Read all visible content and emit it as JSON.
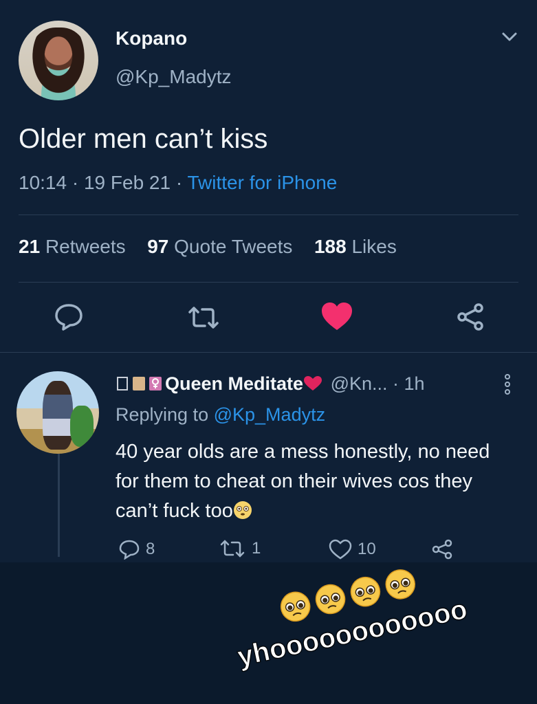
{
  "tweet": {
    "author": {
      "display_name": "Kopano",
      "handle": "@Kp_Madytz"
    },
    "text": "Older men can’t kiss",
    "time": "10:14",
    "date": "19 Feb 21",
    "source": "Twitter for iPhone",
    "stats": {
      "retweets_count": "21",
      "retweets_label": "Retweets",
      "quotes_count": "97",
      "quotes_label": "Quote Tweets",
      "likes_count": "188",
      "likes_label": "Likes"
    },
    "actions": {
      "reply_icon": "reply-icon",
      "retweet_icon": "retweet-icon",
      "like_icon": "heart-icon",
      "share_icon": "share-icon"
    }
  },
  "reply": {
    "display_name": "Queen Meditate",
    "handle": "@Kn...",
    "time": "· 1h",
    "replying_prefix": "Replying to",
    "replying_to": "@Kp_Madytz",
    "text": "40 year olds are a mess honestly, no need for them to cheat on their wives cos they can’t fuck too",
    "counts": {
      "replies": "8",
      "retweets": "1",
      "likes": "10"
    }
  },
  "caption": {
    "text": "yhoooooooooooo",
    "emoji": "pleading-face"
  },
  "colors": {
    "background": "#0f2036",
    "accent_blue": "#2b93e8",
    "like_pink": "#f3306e",
    "muted_text": "#9fb2c6"
  }
}
